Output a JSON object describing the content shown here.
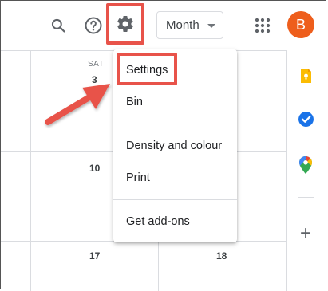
{
  "toolbar": {
    "view_select": "Month",
    "avatar_letter": "B"
  },
  "calendar": {
    "day_header": "SAT",
    "dates": {
      "d3": "3",
      "d10": "10",
      "d17": "17",
      "d18": "18"
    }
  },
  "settings_menu": {
    "items": [
      "Settings",
      "Bin",
      "Density and colour",
      "Print",
      "Get add-ons"
    ]
  },
  "side_panel": {
    "icons": [
      "keep-icon",
      "tasks-icon",
      "maps-icon",
      "add-icon"
    ],
    "add_label": "+"
  },
  "colors": {
    "highlight": "#e8534a",
    "avatar": "#ee5e1c",
    "keep": "#fbbc04",
    "tasks": "#1a73e8"
  }
}
